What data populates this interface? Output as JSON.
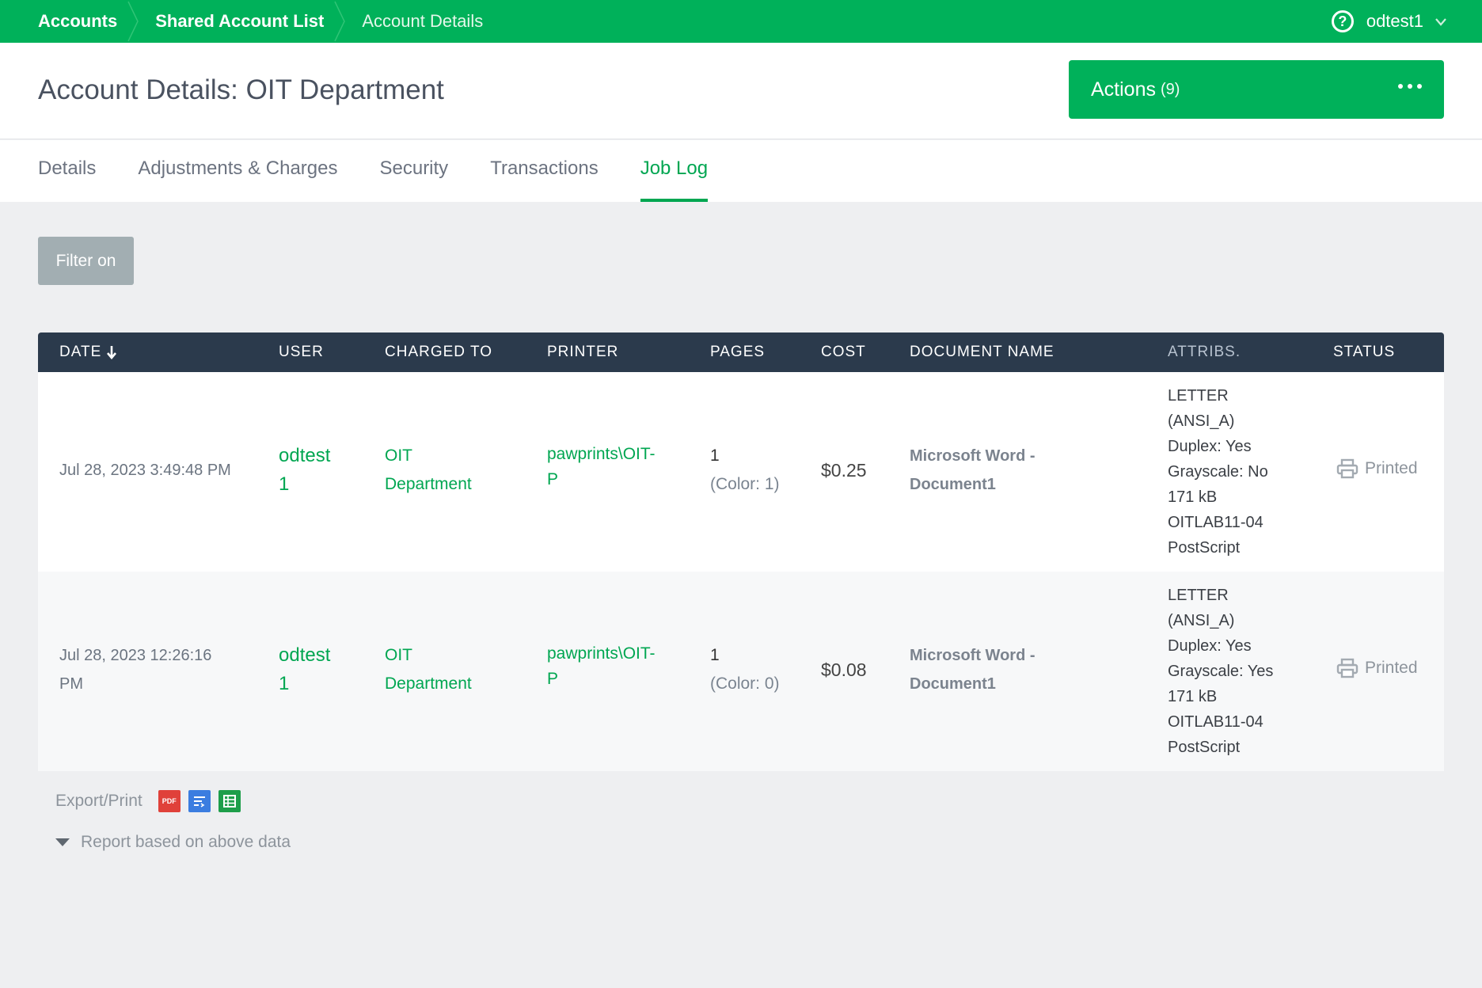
{
  "breadcrumb": {
    "items": [
      {
        "label": "Accounts"
      },
      {
        "label": "Shared Account List"
      },
      {
        "label": "Account Details"
      }
    ]
  },
  "user_menu": {
    "username": "odtest1",
    "help_icon": "help-circle-icon",
    "chevron_icon": "chevron-down-icon"
  },
  "page": {
    "title": "Account Details: OIT Department"
  },
  "actions": {
    "label": "Actions",
    "count": "(9)"
  },
  "tabs": [
    {
      "label": "Details"
    },
    {
      "label": "Adjustments & Charges"
    },
    {
      "label": "Security"
    },
    {
      "label": "Transactions"
    },
    {
      "label": "Job Log",
      "active": true
    }
  ],
  "filter": {
    "label": "Filter on"
  },
  "table": {
    "columns": [
      "DATE",
      "USER",
      "CHARGED TO",
      "PRINTER",
      "PAGES",
      "COST",
      "DOCUMENT NAME",
      "ATTRIBS.",
      "STATUS"
    ],
    "rows": [
      {
        "date": "Jul 28, 2023 3:49:48 PM",
        "user_line1": "odtest",
        "user_line2": "1",
        "charged_line1": "OIT",
        "charged_line2": "Department",
        "printer_line1": "pawprints\\OIT-",
        "printer_line2": "P",
        "pages": "1",
        "pages_color": "(Color: 1)",
        "cost": "$0.25",
        "doc_line1": "Microsoft Word -",
        "doc_line2": "Document1",
        "attribs": [
          "LETTER",
          "(ANSI_A)",
          "Duplex: Yes",
          "Grayscale: No",
          "171 kB",
          "OITLAB11-04",
          "PostScript"
        ],
        "status": "Printed"
      },
      {
        "date_line1": "Jul 28, 2023 12:26:16",
        "date_line2": "PM",
        "user_line1": "odtest",
        "user_line2": "1",
        "charged_line1": "OIT",
        "charged_line2": "Department",
        "printer_line1": "pawprints\\OIT-",
        "printer_line2": "P",
        "pages": "1",
        "pages_color": "(Color: 0)",
        "cost": "$0.08",
        "doc_line1": "Microsoft Word -",
        "doc_line2": "Document1",
        "attribs": [
          "LETTER",
          "(ANSI_A)",
          "Duplex: Yes",
          "Grayscale: Yes",
          "171 kB",
          "OITLAB11-04",
          "PostScript"
        ],
        "status": "Printed"
      }
    ]
  },
  "export": {
    "label": "Export/Print",
    "pdf_text": "PDF",
    "icons": [
      "pdf-icon",
      "csv-icon",
      "spreadsheet-icon"
    ]
  },
  "report": {
    "label": "Report based on above data"
  },
  "colors": {
    "brand_green": "#00b15a",
    "table_header": "#2b3a4c",
    "link_green": "#00a651"
  }
}
